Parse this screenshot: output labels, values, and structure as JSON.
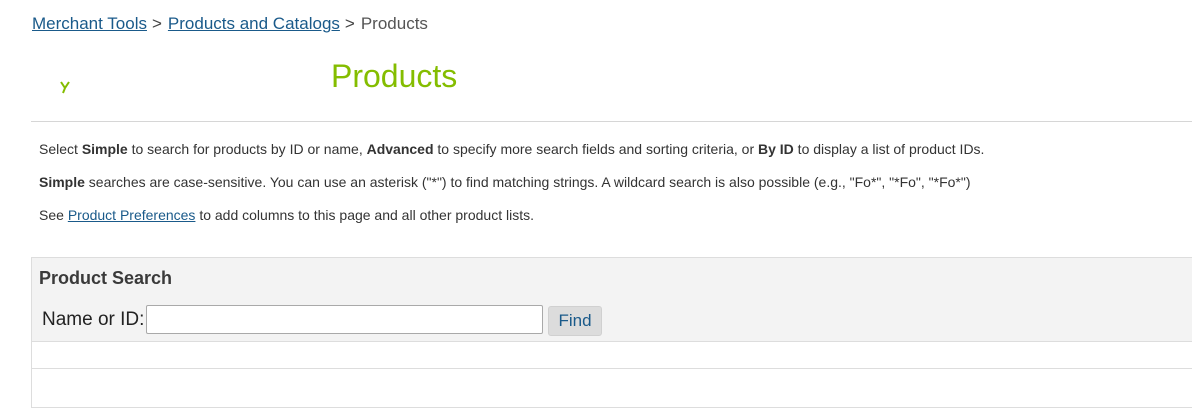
{
  "breadcrumb": {
    "items": [
      {
        "label": "Merchant Tools"
      },
      {
        "label": "Products and Catalogs"
      }
    ],
    "separator": ">",
    "current": "Products"
  },
  "page": {
    "title": "Products",
    "title_color": "#84bd00"
  },
  "help": {
    "line1": {
      "pre": "Select ",
      "simple": "Simple",
      "mid1": " to search for products by ID or name, ",
      "advanced": "Advanced",
      "mid2": " to specify more search fields and sorting criteria, or ",
      "byid": "By ID",
      "post": " to display a list of product IDs."
    },
    "line2": {
      "simple": "Simple",
      "text": " searches are case-sensitive. You can use an asterisk (\"*\") to find matching strings. A wildcard search is also possible (e.g., \"Fo*\", \"*Fo\", \"*Fo*\")"
    },
    "line3": {
      "pre": "See ",
      "link": "Product Preferences",
      "post": " to add columns to this page and all other product lists."
    }
  },
  "search": {
    "title": "Product Search",
    "name_label": "Name or ID:",
    "name_value": "",
    "find_label": "Find"
  },
  "colors": {
    "link": "#1a5a8a",
    "panel_bg": "#f3f3f3",
    "button_bg": "#dcdcdc"
  }
}
